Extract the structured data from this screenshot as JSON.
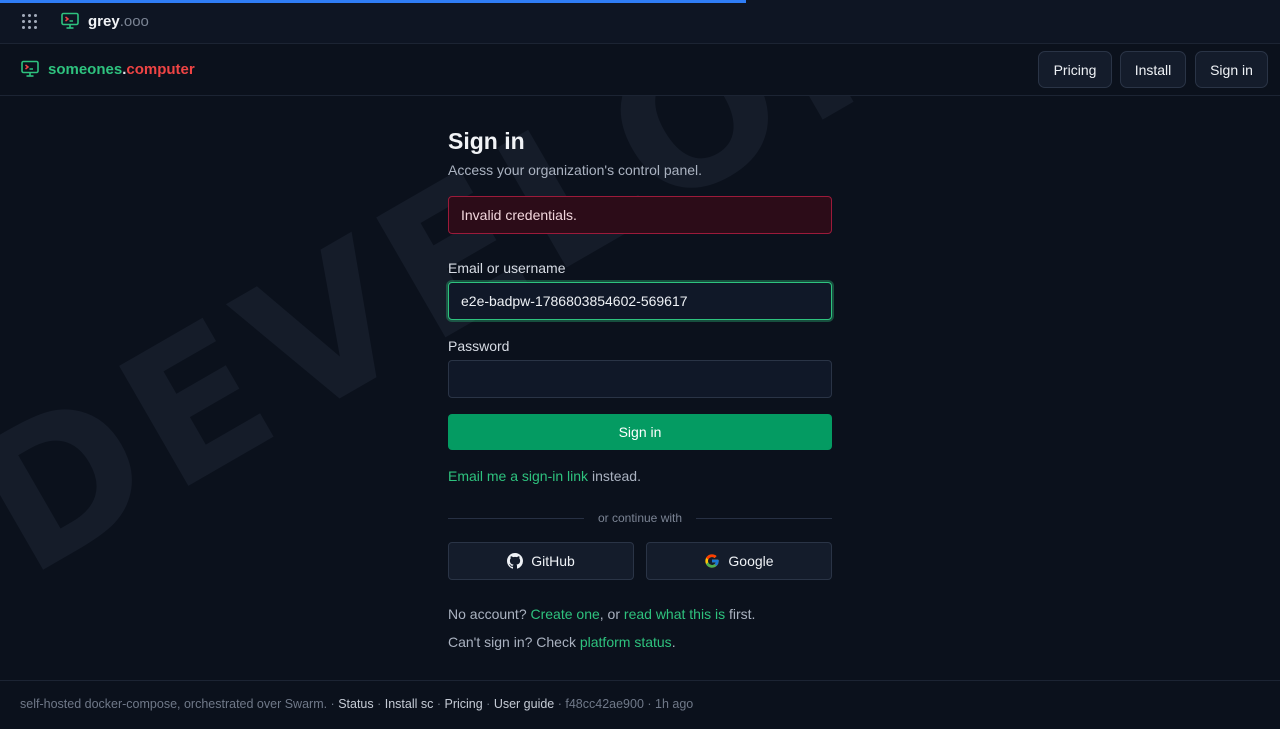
{
  "topbar": {
    "brand_name": "grey",
    "brand_tld": ".ooo",
    "icons": [
      "apps-grid-icon",
      "terminal-monitor-icon"
    ]
  },
  "navbar": {
    "brand_part1": "someones",
    "brand_dot": ".",
    "brand_part2": "computer",
    "buttons": {
      "pricing": "Pricing",
      "install": "Install",
      "signin": "Sign in"
    }
  },
  "watermark": "DEVELOPMENT",
  "form": {
    "title": "Sign in",
    "subtitle": "Access your organization's control panel.",
    "error": "Invalid credentials.",
    "email_label": "Email or username",
    "email_value": "e2e-badpw-1786803854602-569617",
    "password_label": "Password",
    "password_value": "",
    "submit": "Sign in",
    "magic_link": "Email me a sign-in link",
    "magic_suffix": " instead.",
    "divider": "or continue with",
    "github": "GitHub",
    "google": "Google",
    "no_account_prefix": "No account? ",
    "create_one": "Create one",
    "or_text": ", or ",
    "read_what": "read what this is",
    "first_text": " first.",
    "cant_prefix": "Can't sign in? Check ",
    "platform_status": "platform status",
    "period": "."
  },
  "footer": {
    "desc": "self-hosted docker-compose, orchestrated over Swarm.",
    "sep": " · ",
    "status": "Status",
    "install": "Install sc",
    "pricing": "Pricing",
    "guide": "User guide",
    "commit": "f48cc42ae900",
    "ago": "1h ago"
  },
  "colors": {
    "accent": "#2ec27e",
    "brand_red": "#ef4444",
    "button_green": "#049b62",
    "error_border": "#9c1a3a",
    "progress": "#2f7df6"
  }
}
